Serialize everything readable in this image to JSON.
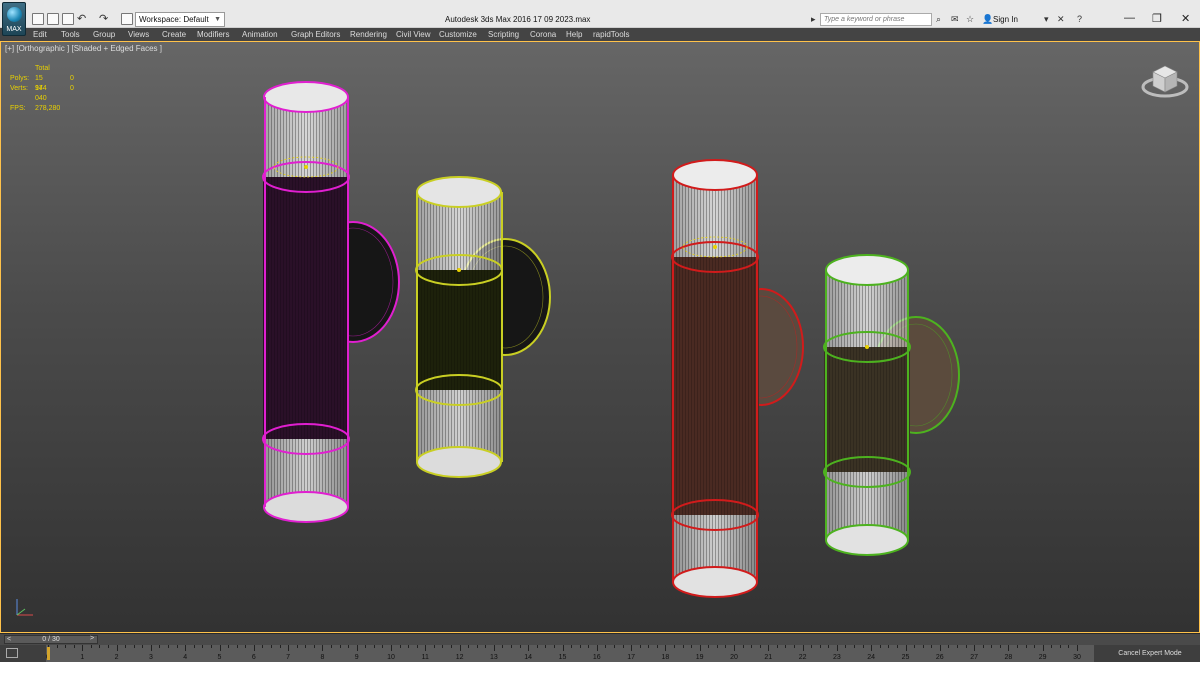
{
  "app": {
    "logo_text": "MAX",
    "title": "Autodesk 3ds Max 2016     17 09 2023.max",
    "workspace": "Workspace: Default",
    "search_placeholder": "Type a keyword or phrase",
    "signin": "Sign In"
  },
  "menu": [
    "Edit",
    "Tools",
    "Group",
    "Views",
    "Create",
    "Modifiers",
    "Animation",
    "Graph Editors",
    "Rendering",
    "Civil View",
    "Customize",
    "Scripting",
    "Corona",
    "Help",
    "rapidTools"
  ],
  "viewport": {
    "label": "[+] [Orthographic ] [Shaded + Edged Faces ]",
    "stats": {
      "header": "Total",
      "polys_label": "Polys:",
      "polys_total": "15 944",
      "polys_sel": "0",
      "verts_label": "Verts:",
      "verts_total": "17 040",
      "verts_sel": "0",
      "fps_label": "FPS:",
      "fps_value": "278,280"
    },
    "objects": [
      {
        "name": "magenta-lamp",
        "color": "#e01fd0"
      },
      {
        "name": "yellow-lamp",
        "color": "#c9cf23"
      },
      {
        "name": "red-lamp",
        "color": "#d11b1b"
      },
      {
        "name": "green-lamp",
        "color": "#4db21f"
      }
    ]
  },
  "timeline": {
    "frame_display": "0 / 30",
    "prev": "<",
    "next": ">",
    "ticks": [
      "0",
      "1",
      "2",
      "3",
      "4",
      "5",
      "6",
      "7",
      "8",
      "9",
      "10",
      "11",
      "12",
      "13",
      "14",
      "15",
      "16",
      "17",
      "18",
      "19",
      "20",
      "21",
      "22",
      "23",
      "24",
      "25",
      "26",
      "27",
      "28",
      "29",
      "30"
    ],
    "current_frame": 0,
    "total_frames": 30
  },
  "status": {
    "cancel_expert": "Cancel Expert Mode"
  },
  "colors": {
    "viewport_border": "#ffc24a",
    "stats_text": "#e8d100",
    "menubar_bg": "#444444"
  }
}
